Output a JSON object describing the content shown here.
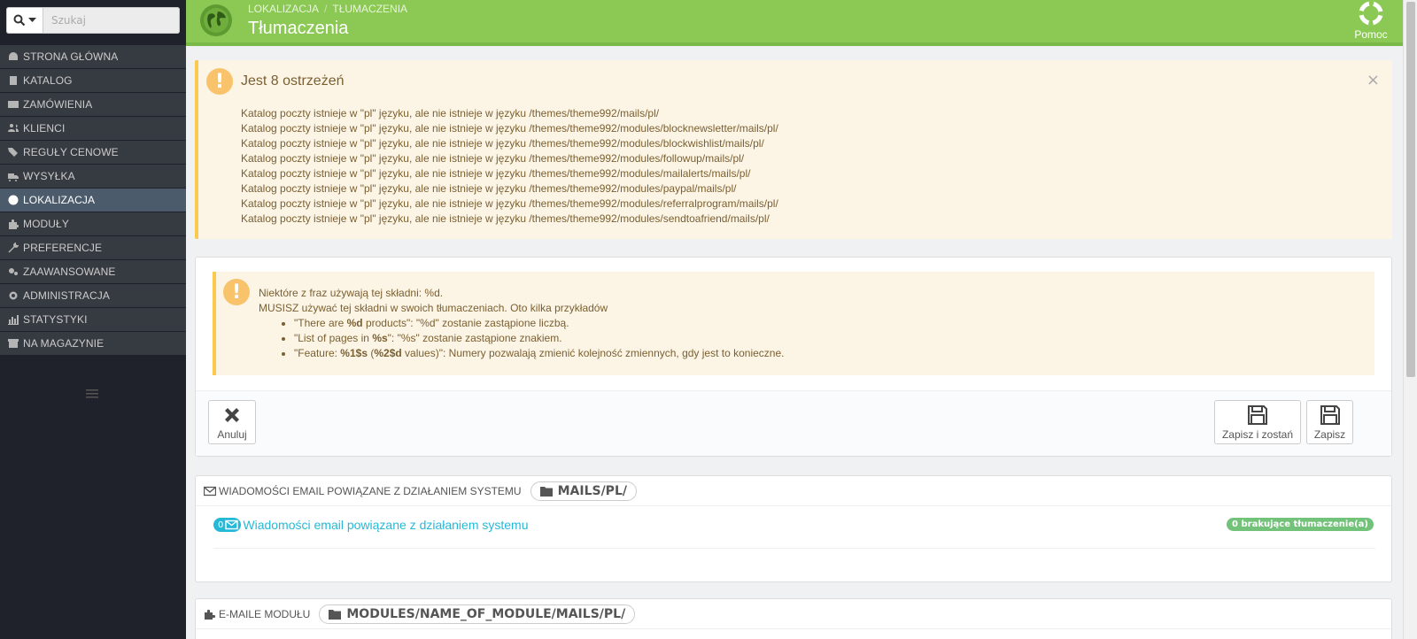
{
  "search": {
    "placeholder": "Szukaj"
  },
  "sidebar": {
    "items": [
      {
        "label": "STRONA GŁÓWNA",
        "icon": "dashboard-icon",
        "active": false
      },
      {
        "label": "KATALOG",
        "icon": "book-icon",
        "active": false
      },
      {
        "label": "ZAMÓWIENIA",
        "icon": "credit-card-icon",
        "active": false
      },
      {
        "label": "KLIENCI",
        "icon": "users-icon",
        "active": false
      },
      {
        "label": "REGUŁY CENOWE",
        "icon": "tags-icon",
        "active": false
      },
      {
        "label": "WYSYŁKA",
        "icon": "truck-icon",
        "active": false
      },
      {
        "label": "LOKALIZACJA",
        "icon": "globe-icon",
        "active": true
      },
      {
        "label": "MODUŁY",
        "icon": "puzzle-icon",
        "active": false
      },
      {
        "label": "PREFERENCJE",
        "icon": "wrench-icon",
        "active": false
      },
      {
        "label": "ZAAWANSOWANE",
        "icon": "cogs-icon",
        "active": false
      },
      {
        "label": "ADMINISTRACJA",
        "icon": "cog-icon",
        "active": false
      },
      {
        "label": "STATYSTYKI",
        "icon": "bar-chart-icon",
        "active": false
      },
      {
        "label": "NA MAGAZYNIE",
        "icon": "archive-icon",
        "active": false
      }
    ]
  },
  "header": {
    "breadcrumb": [
      "LOKALIZACJA",
      "TŁUMACZENIA"
    ],
    "breadcrumb_sep": "/",
    "title": "Tłumaczenia",
    "help_label": "Pomoc",
    "color": "#8bc954"
  },
  "warning": {
    "title": "Jest 8 ostrzeżeń",
    "close": "×",
    "items": [
      "Katalog poczty istnieje w \"pl\" języku, ale nie istnieje w języku /themes/theme992/mails/pl/",
      "Katalog poczty istnieje w \"pl\" języku, ale nie istnieje w języku /themes/theme992/modules/blocknewsletter/mails/pl/",
      "Katalog poczty istnieje w \"pl\" języku, ale nie istnieje w języku /themes/theme992/modules/blockwishlist/mails/pl/",
      "Katalog poczty istnieje w \"pl\" języku, ale nie istnieje w języku /themes/theme992/modules/followup/mails/pl/",
      "Katalog poczty istnieje w \"pl\" języku, ale nie istnieje w języku /themes/theme992/modules/mailalerts/mails/pl/",
      "Katalog poczty istnieje w \"pl\" języku, ale nie istnieje w języku /themes/theme992/modules/paypal/mails/pl/",
      "Katalog poczty istnieje w \"pl\" języku, ale nie istnieje w języku /themes/theme992/modules/referralprogram/mails/pl/",
      "Katalog poczty istnieje w \"pl\" języku, ale nie istnieje w języku /themes/theme992/modules/sendtoafriend/mails/pl/"
    ]
  },
  "info": {
    "line1": "Niektóre z fraz używają tej składni: %d.",
    "line2": "MUSISZ używać tej składni w swoich tłumaczeniach. Oto kilka przykładów",
    "examples": [
      {
        "pre": "\"There are ",
        "bold": "%d",
        "mid": " products\": \"%d\" zostanie zastąpione liczbą.",
        "bold2": "",
        "post": ""
      },
      {
        "pre": "\"List of pages in ",
        "bold": "%s",
        "mid": "\": \"%s\" zostanie zastąpione znakiem.",
        "bold2": "",
        "post": ""
      },
      {
        "pre": "\"Feature: ",
        "bold": "%1$s",
        "mid": " (",
        "bold2": "%2$d",
        "post": " values)\": Numery pozwalają zmienić kolejność zmiennych, gdy jest to konieczne."
      }
    ]
  },
  "toolbar": {
    "cancel_label": "Anuluj",
    "save_stay_label": "Zapisz i zostań",
    "save_label": "Zapisz"
  },
  "mails_section": {
    "heading": "WIADOMOŚCI EMAIL POWIĄZANE Z DZIAŁANIEM SYSTEMU",
    "path": "MAILS/PL/",
    "count": "0",
    "link_label": "Wiadomości email powiązane z działaniem systemu",
    "missing_badge": "0 brakujące tłumaczenie(a)"
  },
  "module_section": {
    "heading": "E-MAILE MODUŁU",
    "path": "MODULES/NAME_OF_MODULE/MAILS/PL/"
  },
  "colors": {
    "accent": "#25b9d7",
    "warning_bg": "#fcf5e5",
    "warning_border": "#fcc94f",
    "success": "#72c279",
    "sidebar_bg": "#1f222a"
  }
}
